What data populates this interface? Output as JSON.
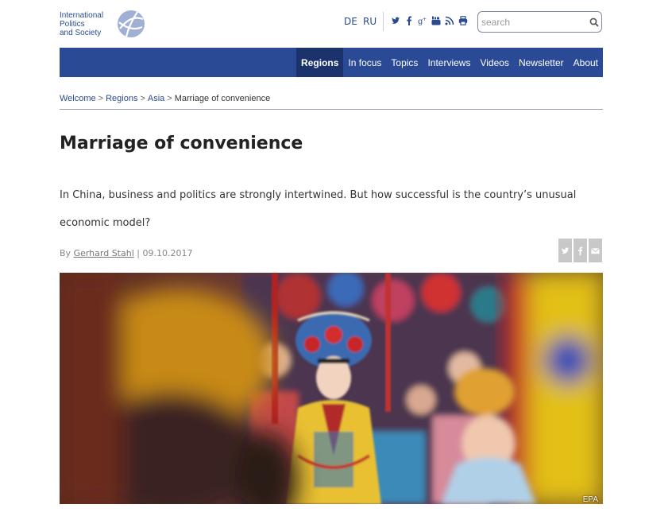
{
  "logo": {
    "lines": [
      "International",
      "Politics",
      "and Society"
    ],
    "icon": "globe-logo"
  },
  "header": {
    "languages": [
      "DE",
      "RU"
    ],
    "social_icons": [
      "twitter-icon",
      "facebook-icon",
      "google-plus-icon",
      "youtube-icon",
      "rss-icon",
      "print-icon"
    ],
    "search": {
      "placeholder": "search",
      "value": ""
    }
  },
  "nav": {
    "items": [
      {
        "label": "Regions",
        "active": true
      },
      {
        "label": "In focus"
      },
      {
        "label": "Topics"
      },
      {
        "label": "Interviews"
      },
      {
        "label": "Videos"
      },
      {
        "label": "Newsletter"
      },
      {
        "label": "About"
      }
    ]
  },
  "breadcrumb": {
    "items": [
      "Welcome",
      "Regions",
      "Asia"
    ],
    "current": "Marriage of convenience",
    "separator": ">"
  },
  "article": {
    "title": "Marriage of convenience",
    "lead": "In China, business and politics are strongly intertwined. But how successful is the country’s unusual economic model?",
    "by": "By",
    "author": "Gerhard Stahl",
    "date_sep": "|",
    "date": "09.10.2017",
    "share_icons": [
      "twitter-icon",
      "facebook-icon",
      "email-icon"
    ],
    "image_credit": "EPA"
  },
  "colors": {
    "brand": "#2b4a96",
    "nav_active": "#1c326c"
  }
}
